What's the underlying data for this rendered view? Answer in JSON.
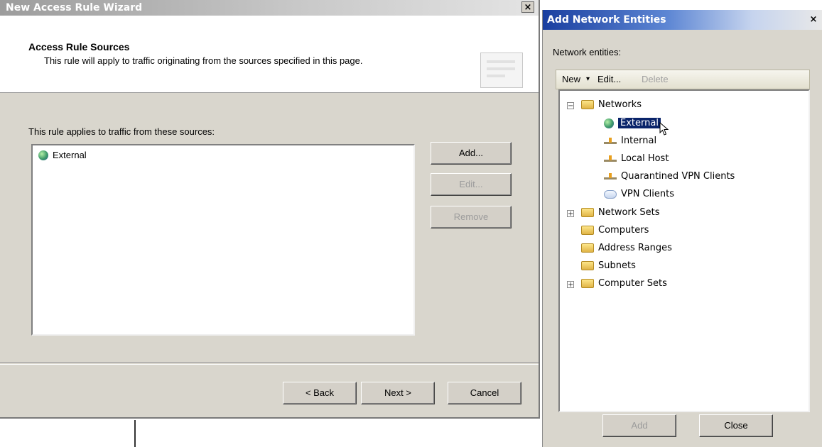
{
  "wizard": {
    "title": "New Access Rule Wizard",
    "close": "×",
    "header_title": "Access Rule Sources",
    "header_subtitle": "This rule will apply to traffic originating from the sources specified in this page.",
    "list_label": "This rule applies to traffic from these sources:",
    "sources": [
      "External"
    ],
    "add_label": "Add...",
    "edit_label": "Edit...",
    "remove_label": "Remove",
    "back_label": "< Back",
    "next_label": "Next >",
    "cancel_label": "Cancel"
  },
  "entities": {
    "title": "Add Network Entities",
    "close": "×",
    "label": "Network entities:",
    "toolbar": {
      "new_label": "New",
      "new_arrow": "▾",
      "edit_label": "Edit...",
      "delete_label": "Delete"
    },
    "tree": {
      "networks": "Networks",
      "external": "External",
      "internal": "Internal",
      "local_host": "Local Host",
      "quarantined": "Quarantined VPN Clients",
      "vpn_clients": "VPN Clients",
      "network_sets": "Network Sets",
      "computers": "Computers",
      "address_ranges": "Address Ranges",
      "subnets": "Subnets",
      "computer_sets": "Computer Sets"
    },
    "add_label": "Add",
    "close_label": "Close"
  },
  "colors": {
    "selection": "#0a246a",
    "title_active": "#1a3fa0",
    "dialog_bg": "#d9d6cd"
  }
}
